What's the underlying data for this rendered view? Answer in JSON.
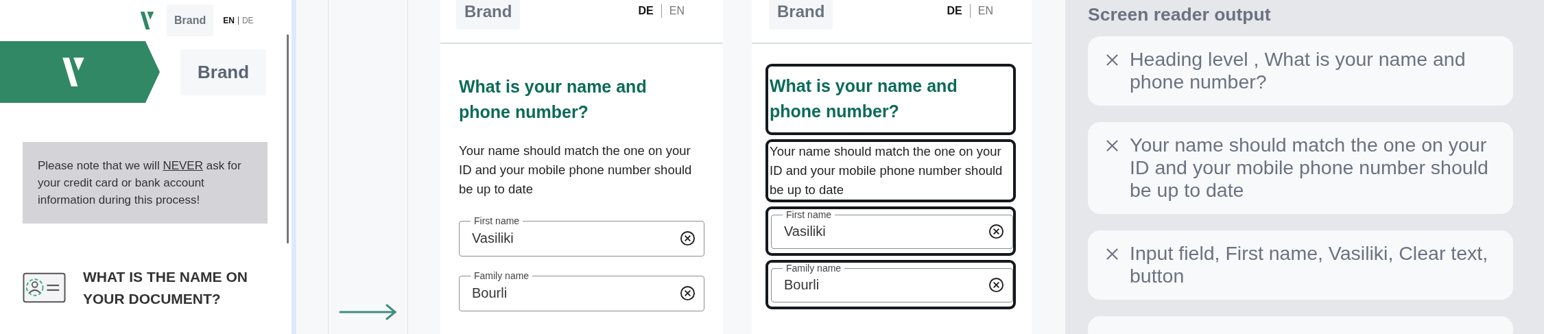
{
  "left_panel": {
    "topbar": {
      "brand": "Brand",
      "languages": [
        {
          "label": "EN",
          "selected": true
        },
        {
          "label": "DE",
          "selected": false
        }
      ]
    },
    "banner": {
      "brand": "Brand"
    },
    "notice": {
      "before": "Please note that we will",
      "emphasis": "NEVER",
      "after": "ask for your credit card or bank account information during this process!"
    },
    "section_heading": "WHAT IS THE NAME ON YOUR DOCUMENT?"
  },
  "phones": [
    {
      "brand": "Brand",
      "focus_outlines": false,
      "languages": [
        {
          "label": "DE",
          "selected": true
        },
        {
          "label": "EN",
          "selected": false
        }
      ],
      "heading": "What is your name and phone number?",
      "description": "Your name should match the one on your ID and your mobile phone number should be up to date",
      "fields": [
        {
          "label": "First name",
          "value": "Vasiliki"
        },
        {
          "label": "Family name",
          "value": "Bourli"
        }
      ]
    },
    {
      "brand": "Brand",
      "focus_outlines": true,
      "languages": [
        {
          "label": "DE",
          "selected": true
        },
        {
          "label": "EN",
          "selected": false
        }
      ],
      "heading": "What is your name and phone number?",
      "description": "Your name should match the one on your ID and your mobile phone number should be up to date",
      "fields": [
        {
          "label": "First name",
          "value": "Vasiliki"
        },
        {
          "label": "Family name",
          "value": "Bourli"
        }
      ]
    }
  ],
  "screen_reader": {
    "title": "Screen reader output",
    "entries": [
      "Heading level , What is your name and phone number?",
      "Your name should match the one on your ID and your mobile phone number should be up to date",
      "Input field, First name, Vasiliki, Clear text, button"
    ]
  }
}
